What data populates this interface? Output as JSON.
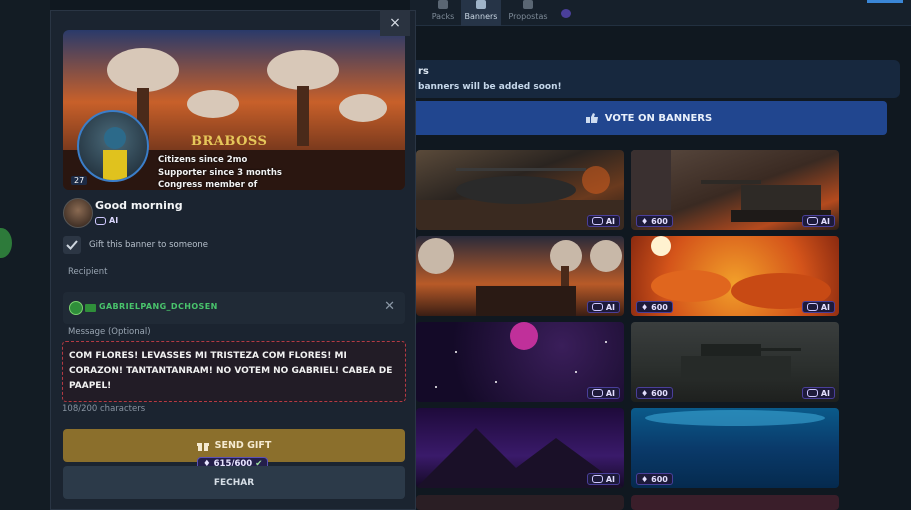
{
  "nav": {
    "tabs": [
      {
        "label": "Packs",
        "active": false
      },
      {
        "label": "Banners",
        "active": true
      },
      {
        "label": "Propostas",
        "active": false
      }
    ]
  },
  "page": {
    "notice_title": "rs",
    "notice_text": "banners will be added soon!",
    "vote_label": "VOTE ON BANNERS",
    "cards": [
      {
        "badge": "AI",
        "theme": "helicopter"
      },
      {
        "badge": "AI",
        "price": "600",
        "theme": "tank-city"
      },
      {
        "badge": "AI",
        "theme": "mushroom-clouds"
      },
      {
        "badge": "AI",
        "price": "600",
        "theme": "orange-clouds"
      },
      {
        "badge": "AI",
        "theme": "space"
      },
      {
        "badge": "AI",
        "price": "600",
        "theme": "tank-field"
      },
      {
        "badge": "AI",
        "theme": "purple-mountains"
      },
      {
        "price": "600",
        "theme": "ocean"
      }
    ]
  },
  "modal": {
    "close_symbol": "×",
    "preview": {
      "name": "BRABOSS",
      "level": "27",
      "citizen_line": "Citizens since 2mo",
      "supporter_line": "Supporter since 3 months",
      "congress_line": "Congress member of"
    },
    "banner_title": "Good morning",
    "banner_tag": "AI",
    "gift_label": "Gift this banner to someone",
    "gift_checked": true,
    "recipient_label": "Recipient",
    "recipient_name": "GABRIELPANG_DCHOSEN",
    "message_label": "Message (Optional)",
    "message_value": "COM FLORES! LEVASSES MI TRISTEZA COM FLORES! MI CORAZON! TANTANTANRAM! NO VOTEM NO GABRIEL! CABEA DE PAAPEL!",
    "char_count": "108/200 characters",
    "send_label": "SEND GIFT",
    "price": "615/600",
    "close_label": "FECHAR"
  },
  "colors": {
    "accent_blue": "#21468f",
    "gold": "#8b6f2c",
    "danger_border": "#b53a43",
    "recipient_green": "#49c46c"
  }
}
